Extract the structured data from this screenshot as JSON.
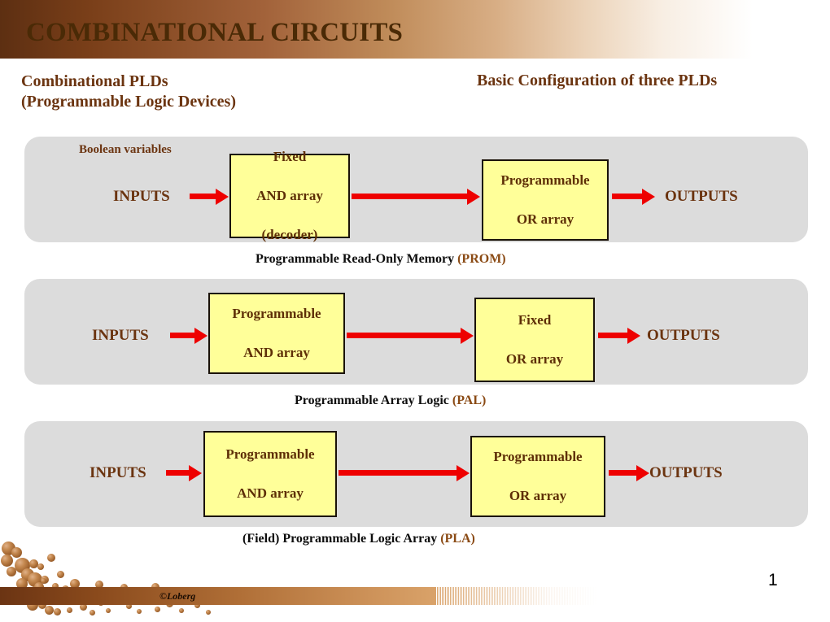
{
  "header": {
    "title": "COMBINATIONAL CIRCUITS",
    "banner_gradient_from": "#5d2f12",
    "banner_gradient_to": "#ffffff"
  },
  "subtitles": {
    "left_line1": "Combinational PLDs",
    "left_line2": "(Programmable Logic Devices)",
    "right": "Basic Configuration of three PLDs"
  },
  "colors": {
    "heading_brown": "#6b3410",
    "title_brown": "#4a2a06",
    "panel_gray": "#dcdcdc",
    "box_yellow": "#ffff99",
    "box_border": "#1a1208",
    "arrow_red": "#ee0000",
    "acronym_brown": "#8a4a14",
    "caption_black": "#0d0d0d"
  },
  "diagrams": [
    {
      "annotation": "Boolean variables",
      "input_label": "INPUTS",
      "output_label": "OUTPUTS",
      "box_left_line1": "Fixed",
      "box_left_line2": "AND array",
      "box_left_line3": "(decoder)",
      "box_right_line1": "Programmable",
      "box_right_line2": "OR array",
      "caption_text": "Programmable Read-Only Memory ",
      "caption_acronym": "(PROM)"
    },
    {
      "input_label": "INPUTS",
      "output_label": "OUTPUTS",
      "box_left_line1": "Programmable",
      "box_left_line2": "AND array",
      "box_right_line1": "Fixed",
      "box_right_line2": "OR array",
      "caption_text": "Programmable Array Logic ",
      "caption_acronym": "(PAL)"
    },
    {
      "input_label": "INPUTS",
      "output_label": "OUTPUTS",
      "box_left_line1": "Programmable",
      "box_left_line2": "AND array",
      "box_right_line1": "Programmable",
      "box_right_line2": "OR array",
      "caption_text": "(Field) Programmable Logic Array ",
      "caption_acronym": "(PLA)"
    }
  ],
  "footer": {
    "copyright": "©Loberg",
    "page_number": "1"
  }
}
